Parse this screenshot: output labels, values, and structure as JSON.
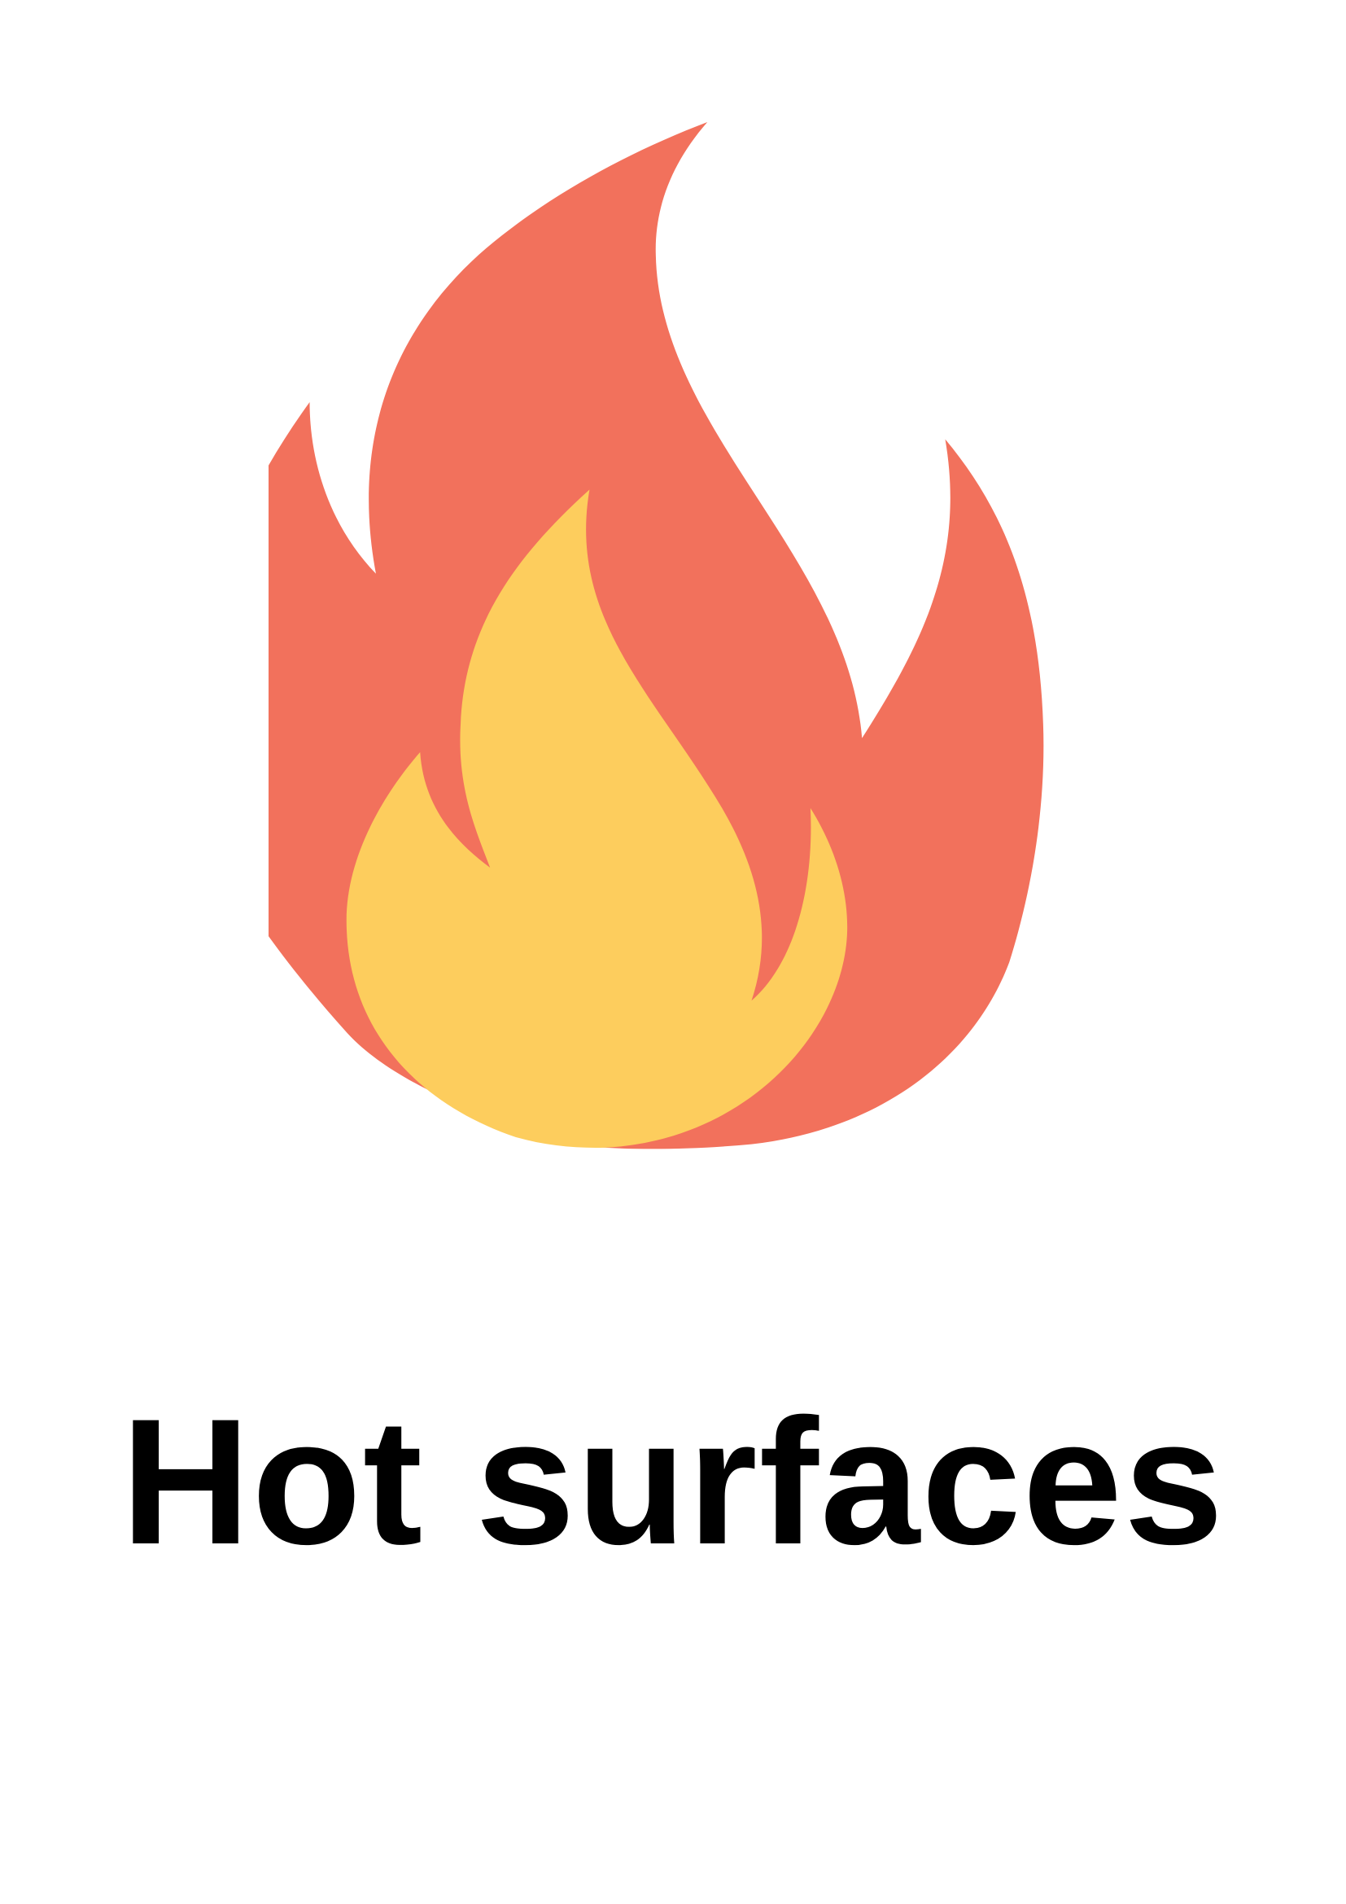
{
  "sign": {
    "caption": "Hot surfaces"
  },
  "icon": {
    "name": "flame-icon",
    "colors": {
      "outer_flame": "#F2715C",
      "inner_flame": "#FDCD5D",
      "background": "#FFFFFF",
      "text": "#000000"
    }
  }
}
